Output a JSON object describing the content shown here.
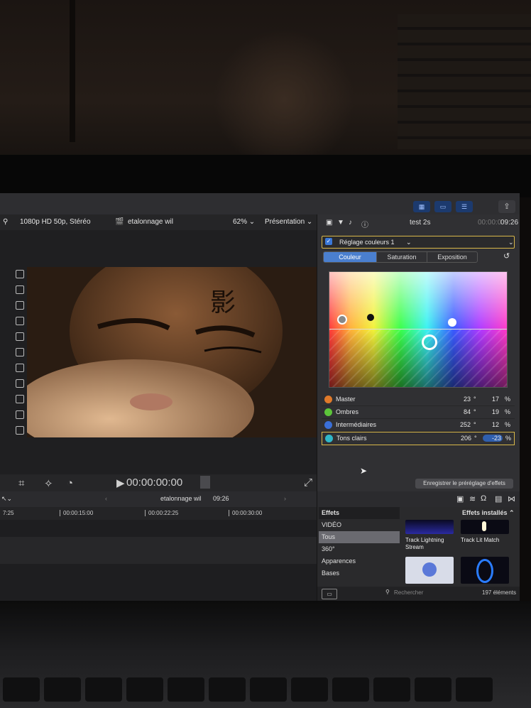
{
  "viewer": {
    "format": "1080p HD 50p, Stéréo",
    "project": "etalonnage wil",
    "zoom": "62%",
    "presentation": "Présentation",
    "timecode": "00:00:00:00"
  },
  "inspector": {
    "clip_name": "test 2s",
    "timecode_prefix": "00:00:0",
    "timecode_main": "09:26",
    "preset": "Réglage couleurs 1",
    "tabs": [
      "Couleur",
      "Saturation",
      "Exposition"
    ],
    "active_tab": "Couleur",
    "rows": [
      {
        "label": "Master",
        "angle": "23",
        "amount": "17",
        "color": "#e07a2a"
      },
      {
        "label": "Ombres",
        "angle": "84",
        "amount": "19",
        "color": "#5cc43a"
      },
      {
        "label": "Intermédiaires",
        "angle": "252",
        "amount": "12",
        "color": "#3a6fd8"
      },
      {
        "label": "Tons clairs",
        "angle": "206",
        "amount": "-23",
        "color": "#2fb7c9"
      }
    ],
    "degree_symbol": "°",
    "percent_symbol": "%",
    "save_label": "Enregistrer le préréglage d'effets"
  },
  "timeline": {
    "project": "etalonnage wil",
    "duration": "09:26",
    "ticks": [
      "7:25",
      "00:00:15:00",
      "00:00:22:25",
      "00:00:30:00"
    ]
  },
  "effects": {
    "title": "Effets",
    "installed": "Effets installés",
    "categories": [
      "VIDÉO",
      "Tous",
      "360°",
      "Apparences",
      "Bases"
    ],
    "active_category": "Tous",
    "items": [
      {
        "name": "Track Lightning Stream"
      },
      {
        "name": "Track Lit Match"
      }
    ],
    "search_placeholder": "Rechercher",
    "count": "197 éléments"
  },
  "colors": {
    "accent": "#d9b84a",
    "selection": "#4a7fcf"
  }
}
